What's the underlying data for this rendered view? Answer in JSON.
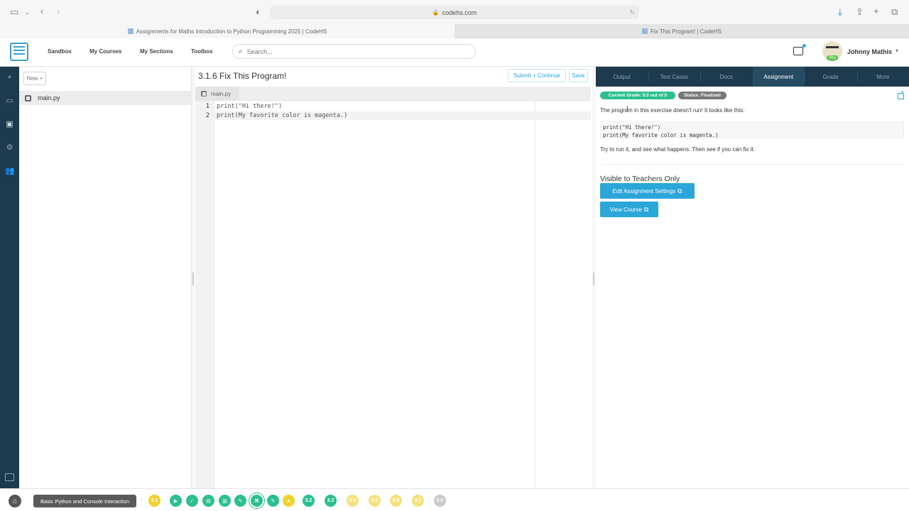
{
  "browser": {
    "url": "codehs.com",
    "tabs": [
      {
        "label": "Assignments for Maths Introduction to Python Programming 2025 | CodeHS",
        "active": true
      },
      {
        "label": "Fix This Program! | CodeHS",
        "active": false
      }
    ]
  },
  "header": {
    "nav": [
      "Sandbox",
      "My Courses",
      "My Sections",
      "Toolbox"
    ],
    "search_placeholder": "Search...",
    "user_name": "Johnny Mathis",
    "avatar_badge": "Pro"
  },
  "files": {
    "new_label": "New +",
    "items": [
      "main.py"
    ]
  },
  "editor": {
    "title": "3.1.6 Fix This Program!",
    "submit_label": "Submit + Continue",
    "save_label": "Save",
    "tab_label": "main.py",
    "lines": [
      {
        "num": "1",
        "code": "print(\"Hi there!\")"
      },
      {
        "num": "2",
        "code": "print(My favorite color is magenta.)"
      }
    ]
  },
  "panel": {
    "tabs": [
      "Output",
      "Test Cases",
      "Docs",
      "Assignment",
      "Grade",
      "More"
    ],
    "active_tab": "Assignment",
    "grade_badge": "Current Grade: 5.0 out of 5",
    "status_badge": "Status: Finalized",
    "intro": "The program in this exercise doesn't run! It looks like this:",
    "code_sample": [
      "print(\"Hi there!\")",
      "print(My favorite color is magenta.)"
    ],
    "instruction": "Try to run it, and see what happens. Then see if you can fix it.",
    "teachers_heading": "Visible to Teachers Only",
    "edit_settings_label": "Edit Assignment Settings",
    "view_course_label": "View Course"
  },
  "bottom": {
    "module_label": "Basic Python and Console Interaction",
    "lessons": [
      "3.1",
      "3.2",
      "3.3",
      "3.4",
      "3.5",
      "3.6",
      "3.7",
      "3.8"
    ]
  },
  "colors": {
    "rail": "#1d3a4e",
    "accent_blue": "#2ba6d9",
    "grade_green": "#2bbf8e",
    "status_grey": "#777777",
    "lesson_yellow": "#f1d22c"
  }
}
